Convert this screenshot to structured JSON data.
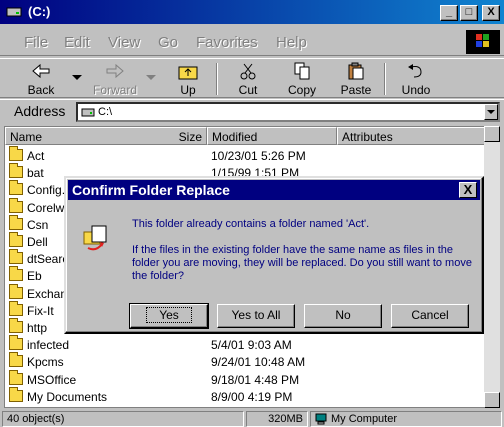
{
  "window": {
    "title": "(C:)",
    "controls": {
      "minimize": "_",
      "maximize": "□",
      "close": "X"
    }
  },
  "menubar": {
    "items": [
      "File",
      "Edit",
      "View",
      "Go",
      "Favorites",
      "Help"
    ]
  },
  "toolbar": {
    "back": "Back",
    "forward": "Forward",
    "up": "Up",
    "cut": "Cut",
    "copy": "Copy",
    "paste": "Paste",
    "undo": "Undo"
  },
  "address": {
    "label": "Address",
    "value": "C:\\"
  },
  "list": {
    "columns": {
      "name": "Name",
      "size": "Size",
      "modified": "Modified",
      "attributes": "Attributes"
    },
    "rows": [
      {
        "name": "Act",
        "modified": "10/23/01 5:26 PM"
      },
      {
        "name": "bat",
        "modified": "1/15/99 1:51 PM"
      },
      {
        "name": "Config.M",
        "modified": ""
      },
      {
        "name": "Corelwe",
        "modified": ""
      },
      {
        "name": "Csn",
        "modified": ""
      },
      {
        "name": "Dell",
        "modified": ""
      },
      {
        "name": "dtSearc",
        "modified": ""
      },
      {
        "name": "Eb",
        "modified": ""
      },
      {
        "name": "Exchang",
        "modified": ""
      },
      {
        "name": "Fix-It",
        "modified": ""
      },
      {
        "name": "http",
        "modified": ""
      },
      {
        "name": "infected",
        "modified": "5/4/01 9:03 AM"
      },
      {
        "name": "Kpcms",
        "modified": "9/24/01 10:48 AM"
      },
      {
        "name": "MSOffice",
        "modified": "9/18/01 4:48 PM"
      },
      {
        "name": "My Documents",
        "modified": "8/9/00 4:19 PM"
      }
    ]
  },
  "status": {
    "objects": "40 object(s)",
    "size": "320MB",
    "location": "My Computer"
  },
  "dialog": {
    "title": "Confirm Folder Replace",
    "close": "X",
    "message1": "This folder already contains a folder named 'Act'.",
    "message2": "If the files in the existing folder have the same name as files in the folder you are moving, they will be replaced.  Do you still want to move the folder?",
    "buttons": {
      "yes": "Yes",
      "yes_all": "Yes to All",
      "no": "No",
      "cancel": "Cancel"
    }
  },
  "colors": {
    "titlebar": "#000080",
    "face": "#c0c0c0",
    "folder": "#f8d848",
    "dialog_text": "#000080"
  }
}
